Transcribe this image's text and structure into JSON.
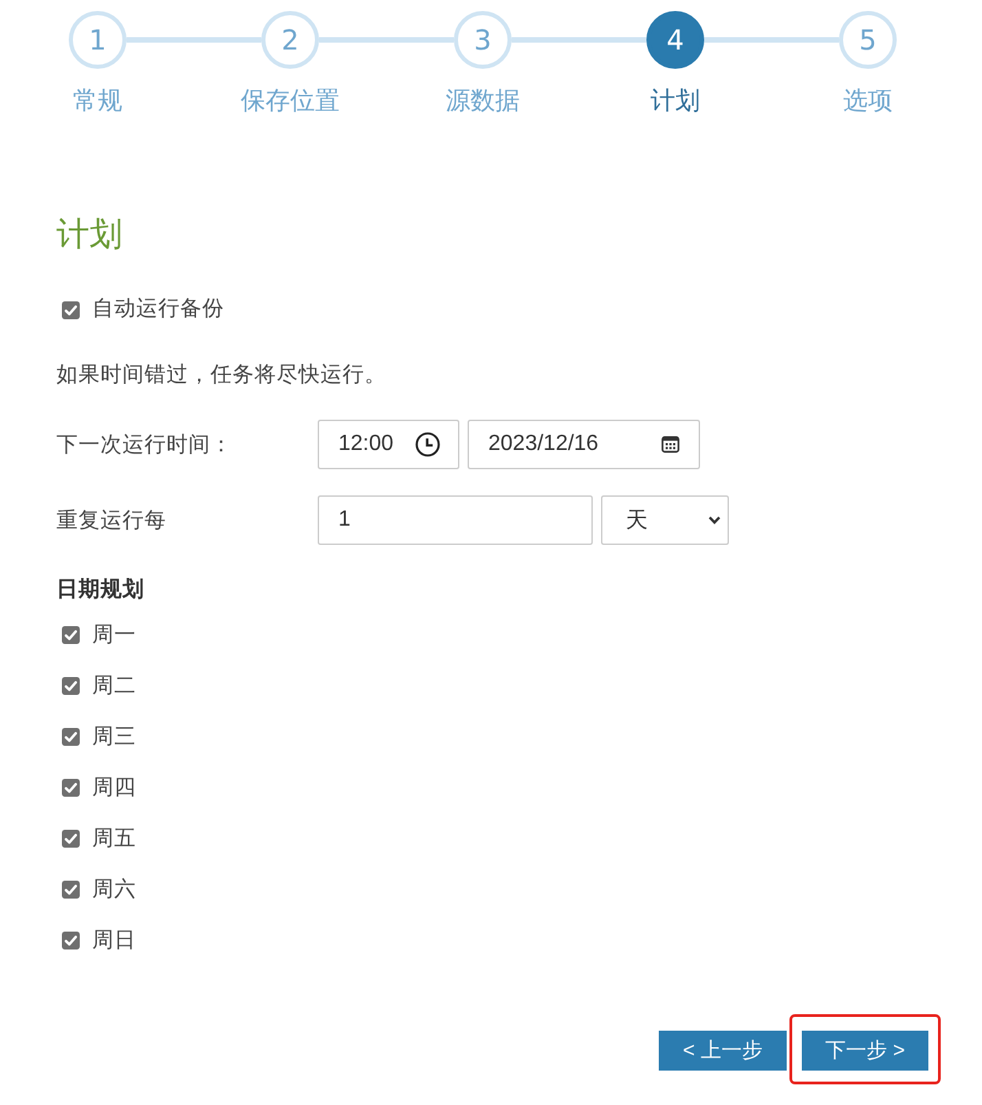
{
  "steps": [
    {
      "number": "1",
      "label": "常规",
      "selected": false
    },
    {
      "number": "2",
      "label": "保存位置",
      "selected": false
    },
    {
      "number": "3",
      "label": "源数据",
      "selected": false
    },
    {
      "number": "4",
      "label": "计划",
      "selected": true
    },
    {
      "number": "5",
      "label": "选项",
      "selected": false
    }
  ],
  "section": {
    "title": "计划"
  },
  "auto_run": {
    "label": "自动运行备份",
    "checked": true
  },
  "note": "如果时间错过，任务将尽快运行。",
  "next_run": {
    "label": "下一次运行时间：",
    "time": "12:00",
    "date": "2023/12/16"
  },
  "repeat": {
    "label": "重复运行每",
    "value": "1",
    "unit": "天"
  },
  "day_schedule": {
    "title": "日期规划",
    "days": [
      {
        "label": "周一",
        "checked": true
      },
      {
        "label": "周二",
        "checked": true
      },
      {
        "label": "周三",
        "checked": true
      },
      {
        "label": "周四",
        "checked": true
      },
      {
        "label": "周五",
        "checked": true
      },
      {
        "label": "周六",
        "checked": true
      },
      {
        "label": "周日",
        "checked": true
      }
    ]
  },
  "buttons": [
    {
      "label": "< 上一步",
      "highlighted": false
    },
    {
      "label": "下一步 >",
      "highlighted": true
    }
  ]
}
